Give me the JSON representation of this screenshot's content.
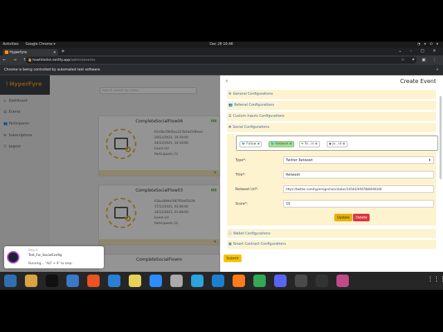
{
  "topbar": {
    "activities": "Activities",
    "app": "Google Chrome ▾",
    "clock": "Dec 28  10:46",
    "tray": "◔ ▾ ⏻ ▾"
  },
  "browser": {
    "tab_title": "Hyperfyre",
    "url_host": "hswhitelist.netlify.app",
    "url_path": "/admin/events",
    "infobar": "Chrome is being controlled by automated test software."
  },
  "sidebar": {
    "brand": "HyperFyre",
    "items": [
      {
        "label": "Dashboard",
        "icon": "⌂"
      },
      {
        "label": "Events",
        "icon": "▤"
      },
      {
        "label": "Participants",
        "icon": "👥"
      },
      {
        "label": "Subscriptions",
        "icon": "⚙"
      },
      {
        "label": "Logout",
        "icon": "⎋"
      }
    ]
  },
  "main": {
    "search_placeholder": "Search events by name",
    "cards": [
      {
        "title": "CompleteSocialFlow06",
        "id": "61c0bc58d5ec217b5de5d6eee",
        "start": "20/12/2021, 10:19:00",
        "end": "24/12/2021, 10:19:00",
        "event_url": "Event Url",
        "participants": "Participants (1)"
      },
      {
        "title": "CompleteSocialFlow03",
        "id": "61bc489fa7667f5d4f1b39",
        "start": "17/12/2021, 03:48:00",
        "end": "24/12/2021, 01:48:00",
        "event_url": "Event Url",
        "participants": "Participants (3)"
      },
      {
        "title": "CompleteSocialFlowm"
      }
    ]
  },
  "drawer": {
    "title": "Create Event",
    "sections": {
      "general": "General Configurations",
      "referral": "Referral Configurations",
      "custom": "Custom Inputs Configurations",
      "social": "Social Configurations",
      "wallet": "Wallet Configurations",
      "smart": "Smart Contract Configurations"
    },
    "social_tabs": [
      "Follow",
      "Retweet",
      "Te...in",
      "Jo...rd"
    ],
    "form": {
      "type_label": "Type*:",
      "type_value": "Twitter Retweet",
      "title_label": "Title*:",
      "title_value": "Retweet",
      "url_label": "Retweet Url*:",
      "url_value": "https://twitter.com/hypersignchain/status/1454424567884046346",
      "score_label": "Score*:",
      "score_value": "10"
    },
    "update_label": "Update",
    "delete_label": "Delete",
    "submit_label": "Submit"
  },
  "notification": {
    "step": "Step 4",
    "name": "Test_For_SocialConfig",
    "status": "Running...  \"ALT + S\" to stop."
  },
  "dock": {
    "apps": [
      {
        "name": "files-icon",
        "color": "#2f6fb3"
      },
      {
        "name": "archive-icon",
        "color": "#d9a441"
      },
      {
        "name": "jetbrains-icon",
        "color": "#111111"
      },
      {
        "name": "document-icon",
        "color": "#3a79c9"
      },
      {
        "name": "store-icon",
        "color": "#e95420"
      },
      {
        "name": "mail-icon",
        "color": "#2a7fd4"
      },
      {
        "name": "disc-icon",
        "color": "#e6d25a"
      },
      {
        "name": "zoom-icon",
        "color": "#2d8cff"
      },
      {
        "name": "folder-icon",
        "color": "#aaaaaa"
      },
      {
        "name": "telegram-icon",
        "color": "#2aa3de"
      },
      {
        "name": "vscode-icon",
        "color": "#1c7fd1"
      },
      {
        "name": "firefox-icon",
        "color": "#ff7a1a"
      },
      {
        "name": "chrome-icon",
        "color": "#34a853"
      },
      {
        "name": "discord-icon",
        "color": "#5865f2"
      },
      {
        "name": "calculator-icon",
        "color": "#4a4a4a"
      },
      {
        "name": "terminal-icon",
        "color": "#333333"
      },
      {
        "name": "app-icon",
        "color": "#c04a8a"
      }
    ]
  }
}
